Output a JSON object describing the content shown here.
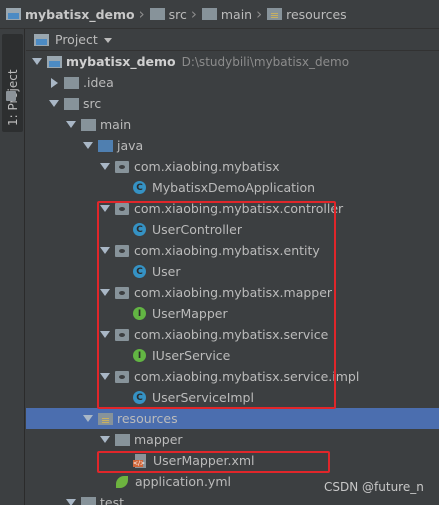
{
  "breadcrumb": {
    "items": [
      {
        "label": "mybatisx_demo",
        "icon": "project-folder-icon"
      },
      {
        "label": "src",
        "icon": "folder-icon"
      },
      {
        "label": "main",
        "icon": "folder-icon"
      },
      {
        "label": "resources",
        "icon": "resources-folder-icon"
      }
    ]
  },
  "left_strip": {
    "tab_label": "1: Project"
  },
  "panel": {
    "title": "Project"
  },
  "tree": {
    "root": {
      "label": "mybatisx_demo",
      "path": "D:\\studybili\\mybatisx_demo"
    },
    "idea": "idea",
    "idea_prefix": ".",
    "src": "src",
    "main": "main",
    "java": "java",
    "pkg_root": "com.xiaobing.mybatisx",
    "app_class": "MybatisxDemoApplication",
    "pkg_controller": "com.xiaobing.mybatisx.controller",
    "user_controller": "UserController",
    "pkg_entity": "com.xiaobing.mybatisx.entity",
    "user": "User",
    "pkg_mapper": "com.xiaobing.mybatisx.mapper",
    "user_mapper": "UserMapper",
    "pkg_service": "com.xiaobing.mybatisx.service",
    "iuser_service": "IUserService",
    "pkg_service_impl": "com.xiaobing.mybatisx.service.impl",
    "user_service_impl": "UserServiceImpl",
    "resources": "resources",
    "mapper": "mapper",
    "user_mapper_xml": "UserMapper.xml",
    "application_yml": "application.yml",
    "test": "test"
  },
  "badges": {
    "class": "C",
    "interface": "I",
    "xml": "</>"
  },
  "colors": {
    "background": "#3c3f41",
    "selection": "#4b6eaf",
    "highlight_box": "#e0262a",
    "class_badge": "#3592c4",
    "interface_badge": "#62b543"
  },
  "watermark": "CSDN @future_n"
}
